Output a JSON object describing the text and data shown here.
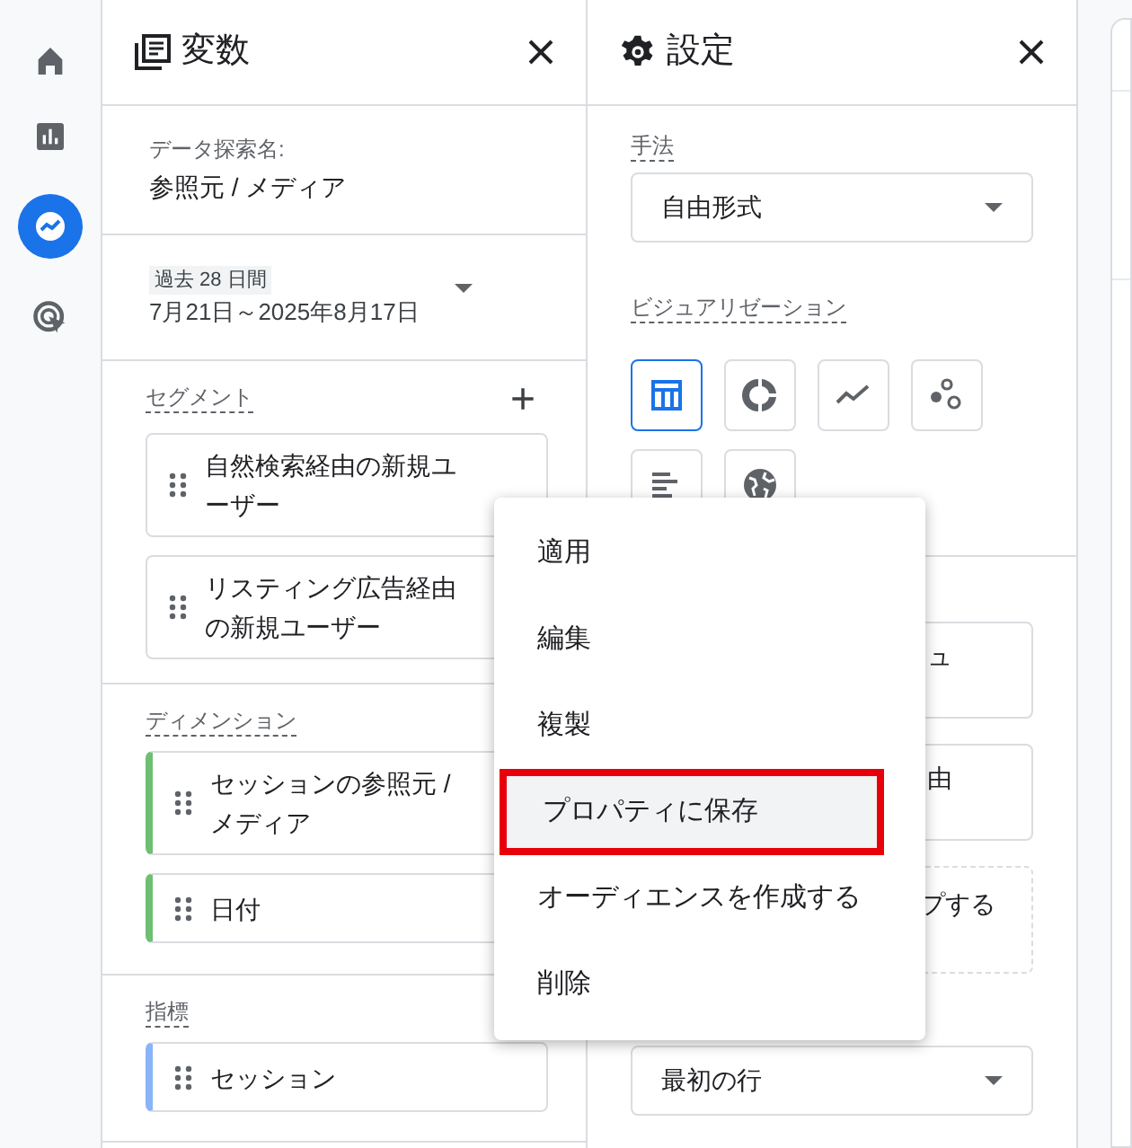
{
  "variables_panel": {
    "title": "変数",
    "exploration_name_label": "データ探索名:",
    "exploration_name": "参照元 / メディア",
    "date_badge": "過去 28 日間",
    "date_range": "7月21日～2025年8月17日",
    "sections": [
      {
        "kind": "segment",
        "label": "セグメント",
        "add": "+",
        "items": [
          "自然検索経由の新規ユーザー",
          "リスティング広告経由の新規ユーザー"
        ]
      },
      {
        "kind": "dimension",
        "label": "ディメンション",
        "items": [
          "セッションの参照元 / メディア",
          "日付"
        ]
      },
      {
        "kind": "metric",
        "label": "指標",
        "items": [
          "セッション"
        ]
      }
    ]
  },
  "settings_panel": {
    "title": "設定",
    "technique_label": "手法",
    "technique": "自由形式",
    "visualization_label": "ビジュアリゼーション",
    "visualizations": [
      {
        "kind": "table",
        "selected": true
      },
      {
        "kind": "donut",
        "selected": false
      },
      {
        "kind": "line",
        "selected": false
      },
      {
        "kind": "scatter",
        "selected": false
      },
      {
        "kind": "bar",
        "selected": false
      },
      {
        "kind": "geo",
        "selected": false
      }
    ],
    "cards": [
      {
        "kind": "card",
        "text": "ュ"
      },
      {
        "kind": "card",
        "text": "由"
      },
      {
        "kind": "drop",
        "text": "プする"
      }
    ],
    "start_row": "最初の行"
  },
  "context_menu": [
    {
      "label": "適用",
      "selected": false
    },
    {
      "label": "編集",
      "selected": false
    },
    {
      "label": "複製",
      "selected": false
    },
    {
      "label": "プロパティに保存",
      "selected": true
    },
    {
      "label": "オーディエンスを作成する",
      "selected": false
    },
    {
      "label": "削除",
      "selected": false
    }
  ]
}
